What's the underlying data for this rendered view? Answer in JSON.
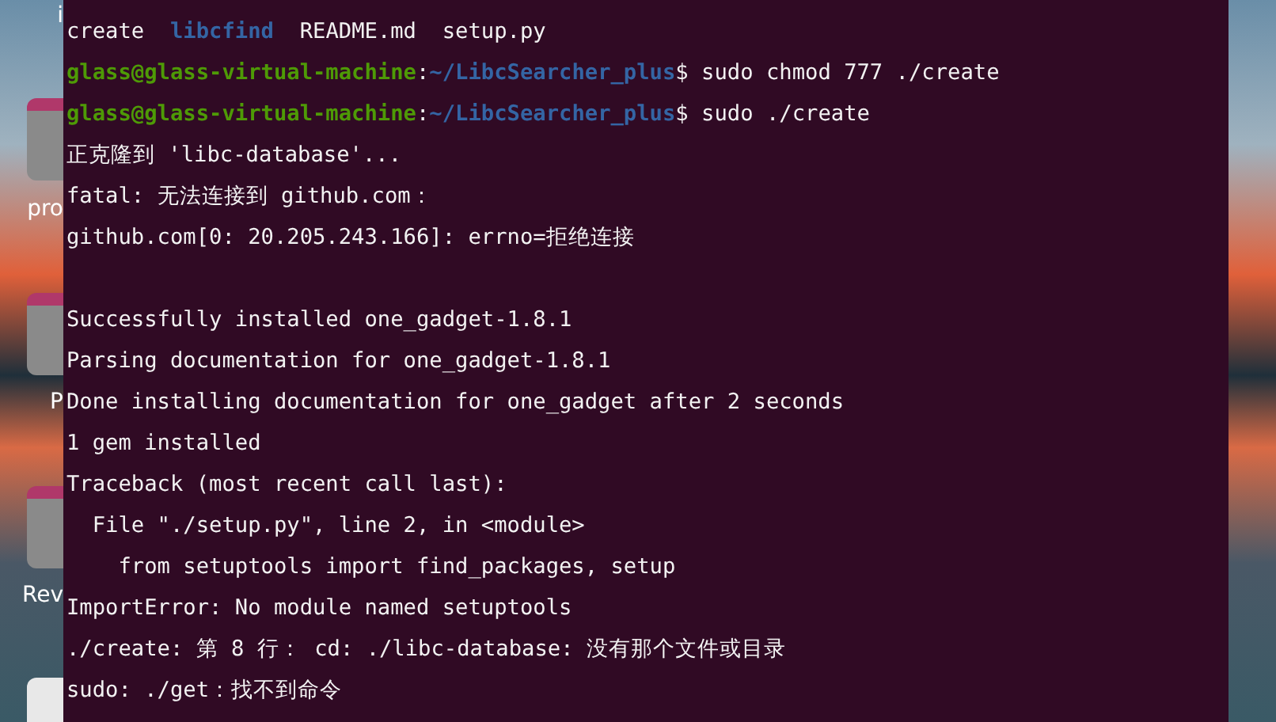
{
  "desktop_icons": [
    {
      "label": "i"
    },
    {
      "label": "pro"
    },
    {
      "label": "P"
    },
    {
      "label": "Rev"
    }
  ],
  "terminal": {
    "lines": [
      {
        "kind": "text",
        "segments": [
          {
            "kind": "plain",
            "text": "create  "
          },
          {
            "kind": "dir",
            "text": "libcfind"
          },
          {
            "kind": "plain",
            "text": "  README.md  setup.py"
          }
        ]
      },
      {
        "kind": "text",
        "segments": [
          {
            "kind": "user",
            "text": "glass@glass-virtual-machine"
          },
          {
            "kind": "plain",
            "text": ":"
          },
          {
            "kind": "path",
            "text": "~/LibcSearcher_plus"
          },
          {
            "kind": "plain",
            "text": "$ sudo chmod 777 ./create"
          }
        ]
      },
      {
        "kind": "text",
        "segments": [
          {
            "kind": "user",
            "text": "glass@glass-virtual-machine"
          },
          {
            "kind": "plain",
            "text": ":"
          },
          {
            "kind": "path",
            "text": "~/LibcSearcher_plus"
          },
          {
            "kind": "plain",
            "text": "$ sudo ./create"
          }
        ]
      },
      {
        "kind": "text",
        "segments": [
          {
            "kind": "plain",
            "text": "正克隆到 'libc-database'..."
          }
        ]
      },
      {
        "kind": "text",
        "segments": [
          {
            "kind": "plain",
            "text": "fatal: 无法连接到 github.com："
          }
        ]
      },
      {
        "kind": "text",
        "segments": [
          {
            "kind": "plain",
            "text": "github.com[0: 20.205.243.166]: errno=拒绝连接"
          }
        ]
      },
      {
        "kind": "blank"
      },
      {
        "kind": "text",
        "segments": [
          {
            "kind": "plain",
            "text": "Successfully installed one_gadget-1.8.1"
          }
        ]
      },
      {
        "kind": "text",
        "segments": [
          {
            "kind": "plain",
            "text": "Parsing documentation for one_gadget-1.8.1"
          }
        ]
      },
      {
        "kind": "text",
        "segments": [
          {
            "kind": "plain",
            "text": "Done installing documentation for one_gadget after 2 seconds"
          }
        ]
      },
      {
        "kind": "text",
        "segments": [
          {
            "kind": "plain",
            "text": "1 gem installed"
          }
        ]
      },
      {
        "kind": "text",
        "segments": [
          {
            "kind": "plain",
            "text": "Traceback (most recent call last):"
          }
        ]
      },
      {
        "kind": "text",
        "segments": [
          {
            "kind": "plain",
            "text": "  File \"./setup.py\", line 2, in <module>"
          }
        ]
      },
      {
        "kind": "text",
        "segments": [
          {
            "kind": "plain",
            "text": "    from setuptools import find_packages, setup"
          }
        ]
      },
      {
        "kind": "text",
        "segments": [
          {
            "kind": "plain",
            "text": "ImportError: No module named setuptools"
          }
        ]
      },
      {
        "kind": "text",
        "segments": [
          {
            "kind": "plain",
            "text": "./create: 第 8 行： cd: ./libc-database: 没有那个文件或目录"
          }
        ]
      },
      {
        "kind": "text",
        "segments": [
          {
            "kind": "plain",
            "text": "sudo: ./get：找不到命令"
          }
        ]
      }
    ]
  }
}
